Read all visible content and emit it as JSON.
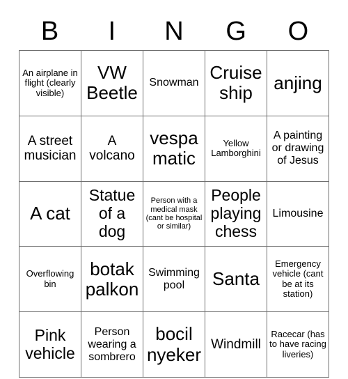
{
  "card": {
    "headers": [
      "B",
      "I",
      "N",
      "G",
      "O"
    ],
    "rows": [
      [
        {
          "text": "An airplane in flight (clearly visible)",
          "size": "fs-s"
        },
        {
          "text": "VW Beetle",
          "size": "fs-xxl"
        },
        {
          "text": "Snowman",
          "size": "fs-m"
        },
        {
          "text": "Cruise ship",
          "size": "fs-xxl"
        },
        {
          "text": "anjing",
          "size": "fs-xxl"
        }
      ],
      [
        {
          "text": "A street musician",
          "size": "fs-l"
        },
        {
          "text": "A volcano",
          "size": "fs-l"
        },
        {
          "text": "vespa matic",
          "size": "fs-xxl"
        },
        {
          "text": "Yellow Lamborghini",
          "size": "fs-s"
        },
        {
          "text": "A painting or drawing of Jesus",
          "size": "fs-m"
        }
      ],
      [
        {
          "text": "A cat",
          "size": "fs-xxl"
        },
        {
          "text": "Statue of a dog",
          "size": "fs-xl"
        },
        {
          "text": "Person with a medical mask (cant be hospital or similar)",
          "size": "fs-xs"
        },
        {
          "text": "People playing chess",
          "size": "fs-xl"
        },
        {
          "text": "Limousine",
          "size": "fs-m"
        }
      ],
      [
        {
          "text": "Overflowing bin",
          "size": "fs-s"
        },
        {
          "text": "botak palkon",
          "size": "fs-xxl"
        },
        {
          "text": "Swimming pool",
          "size": "fs-m"
        },
        {
          "text": "Santa",
          "size": "fs-xxl"
        },
        {
          "text": "Emergency vehicle (cant be at its station)",
          "size": "fs-s"
        }
      ],
      [
        {
          "text": "Pink vehicle",
          "size": "fs-xl"
        },
        {
          "text": "Person wearing a sombrero",
          "size": "fs-m"
        },
        {
          "text": "bocil nyeker",
          "size": "fs-xxl"
        },
        {
          "text": "Windmill",
          "size": "fs-l"
        },
        {
          "text": "Racecar (has to have racing liveries)",
          "size": "fs-s"
        }
      ]
    ]
  },
  "colors": {
    "background": "#ffffff",
    "text": "#000000",
    "border": "#6f6f6f"
  }
}
